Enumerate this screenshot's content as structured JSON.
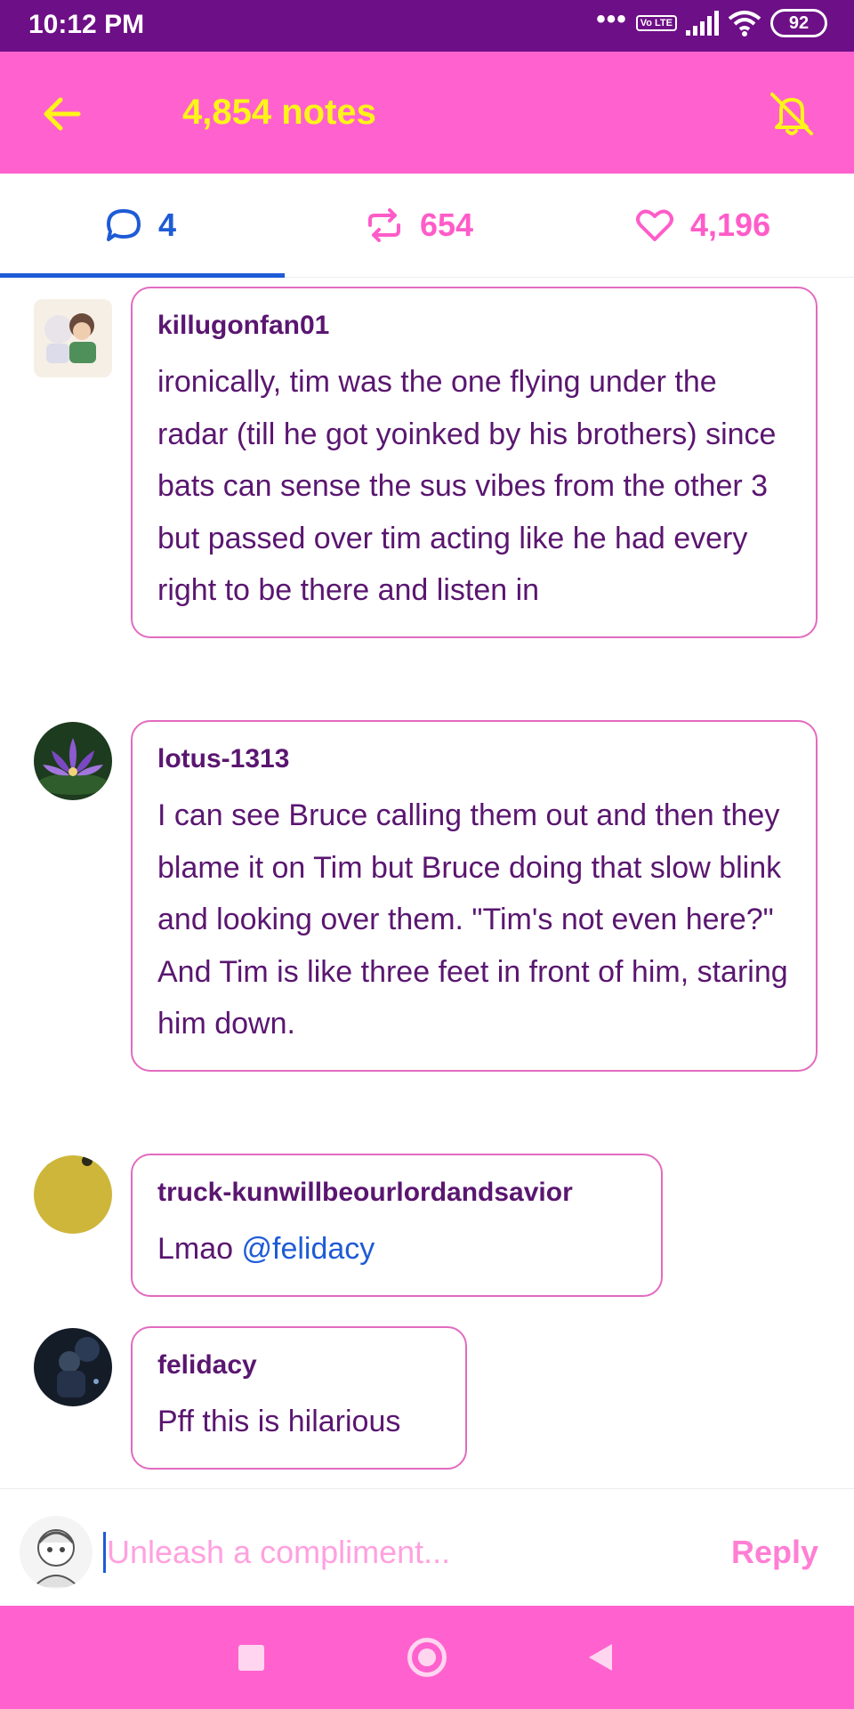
{
  "status_bar": {
    "time": "10:12 PM",
    "signal_label": "Vo LTE",
    "battery": "92",
    "dots": "•••"
  },
  "header": {
    "title": "4,854 notes",
    "back_icon": "arrow-left-icon",
    "mute_icon": "bell-off-icon",
    "accent_color": "#ff62ce",
    "title_color": "#fff41a"
  },
  "tabs": {
    "replies_count": "4",
    "reblogs_count": "654",
    "likes_count": "4,196",
    "active": "replies",
    "active_color": "#1e5bd6"
  },
  "comments": [
    {
      "username": "killugonfan01",
      "text": "ironically, tim was the one flying under the radar (till he got yoinked by his brothers) since bats can sense the sus vibes from the other 3 but passed over tim acting like he had every right to be there and listen in"
    },
    {
      "username": "lotus-1313",
      "text": "I can see Bruce calling them out and then they blame it on Tim but Bruce doing that slow blink and looking over them. \"Tim's not even here?\" And Tim is like three feet in front of him, staring him down."
    },
    {
      "username": "truck-kunwillbeourlordandsavior",
      "text": "Lmao ",
      "mention": "@felidacy"
    },
    {
      "username": "felidacy",
      "text": "Pff this is hilarious"
    }
  ],
  "reply_bar": {
    "placeholder": "Unleash a compliment...",
    "reply_label": "Reply"
  }
}
